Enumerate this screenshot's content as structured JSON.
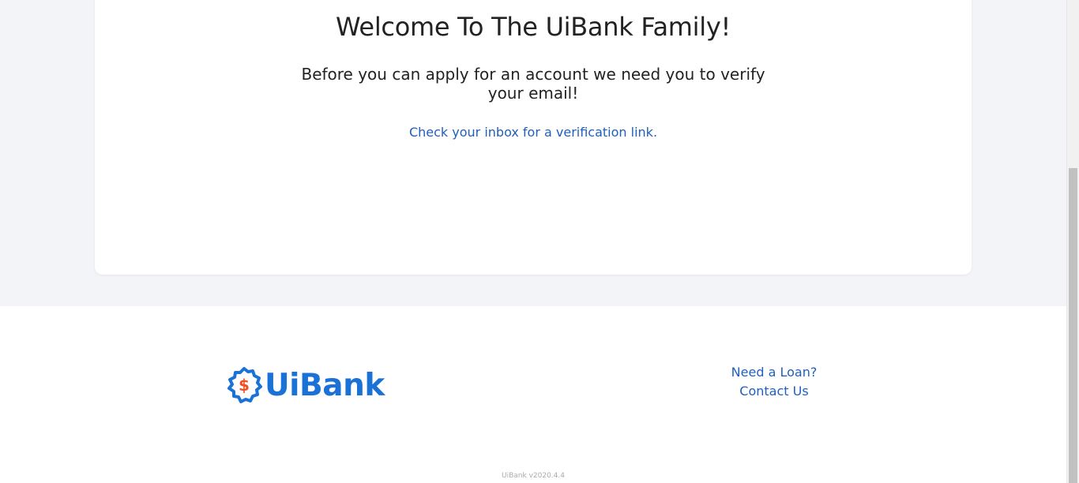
{
  "card": {
    "title": "Welcome To The UiBank Family!",
    "subtitle": "Before you can apply for an account we need you to verify your email!",
    "note": "Check your inbox for a verification link."
  },
  "footer": {
    "logo_text": "UiBank",
    "logo_symbol": "$",
    "links": [
      "Need a Loan?",
      "Contact Us"
    ],
    "version": "UiBank v2020.4.4"
  },
  "colors": {
    "brand_blue": "#1a72d6",
    "link_blue": "#1f5fbf",
    "badge_orange": "#f04e23"
  },
  "icons": {
    "logo_badge": "dollar-badge-icon"
  }
}
